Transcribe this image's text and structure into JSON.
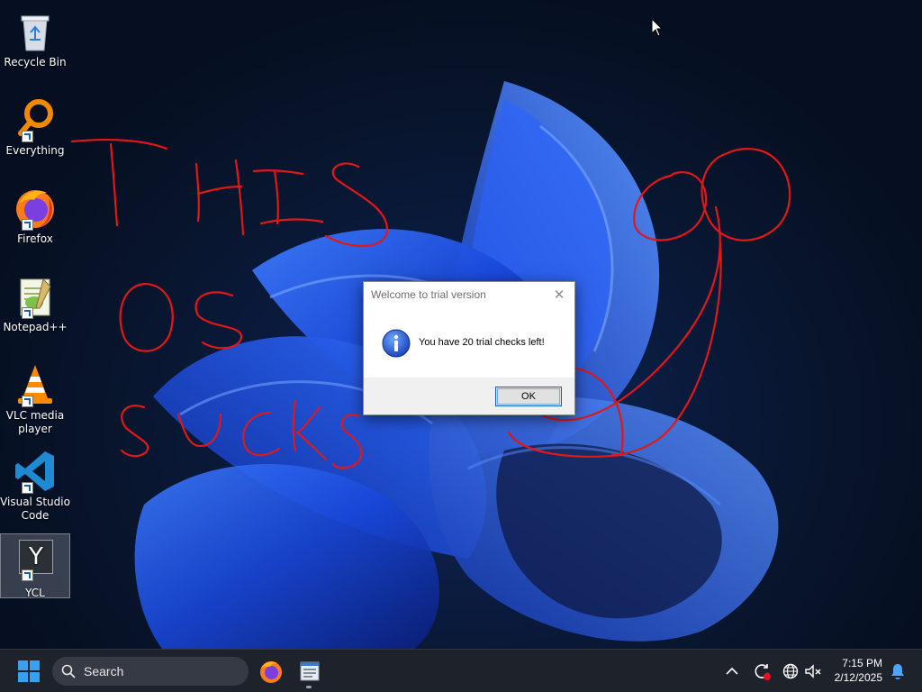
{
  "desktop": {
    "icons": [
      {
        "label": "Recycle Bin",
        "icon": "recycle-bin-icon"
      },
      {
        "label": "Everything",
        "icon": "everything-search-icon"
      },
      {
        "label": "Firefox",
        "icon": "firefox-icon"
      },
      {
        "label": "Notepad++",
        "icon": "notepad-plus-plus-icon"
      },
      {
        "label": "VLC media player",
        "icon": "vlc-icon"
      },
      {
        "label": "Visual Studio Code",
        "icon": "vscode-icon"
      },
      {
        "label": "YCL",
        "icon": "ycl-icon",
        "glyph": "Y",
        "selected": true
      }
    ],
    "scribble_text": "THIS OS SUCKS"
  },
  "dialog": {
    "title": "Welcome to trial version",
    "close_symbol": "✕",
    "message": "You have 20 trial checks left!",
    "ok_label": "OK",
    "icon": "info-icon"
  },
  "taskbar": {
    "search_label": "Search",
    "pinned": [
      "firefox-icon",
      "notepad-icon"
    ],
    "tray": [
      "chevron-up-icon",
      "sync-icon",
      "network-icon",
      "volume-muted-icon"
    ],
    "time": "7:15 PM",
    "date": "2/12/2025",
    "notification_icon": "bell-icon"
  },
  "colors": {
    "wallpaper_blue": "#1a4fe0",
    "scribble_red": "#e01818",
    "taskbar": "#1e222b",
    "accent": "#0f5fc8"
  }
}
